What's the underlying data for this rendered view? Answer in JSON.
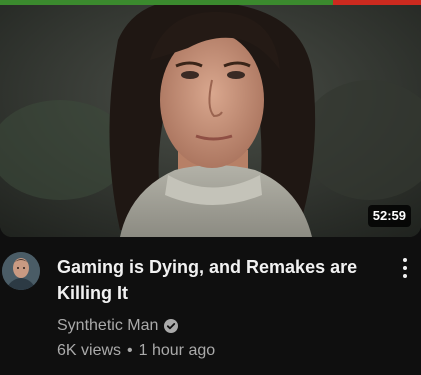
{
  "video": {
    "title": "Gaming is Dying, and Remakes are Killing It",
    "duration": "52:59",
    "watch_progress": 0.79,
    "thumbnail_icon": "video-thumbnail-portrait"
  },
  "channel": {
    "name": "Synthetic Man",
    "verified": true,
    "avatar_icon": "channel-avatar"
  },
  "stats": {
    "views": "6K views",
    "separator": "•",
    "age": "1 hour ago"
  },
  "actions": {
    "menu_icon": "more-vertical-icon"
  },
  "colors": {
    "progress_watched": "#3b8a2e",
    "progress_remaining": "#cc2a1f",
    "text_primary": "#f1f1f1",
    "text_secondary": "#aaaaaa",
    "background": "#0f0f0f"
  }
}
